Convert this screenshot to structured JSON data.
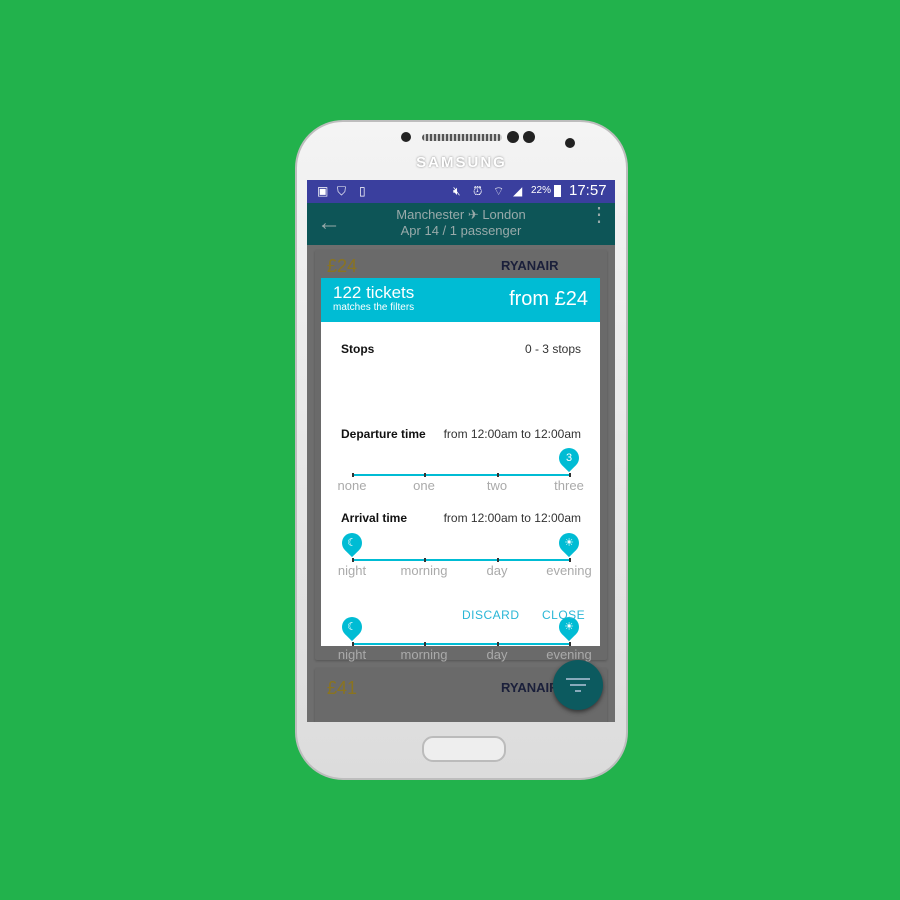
{
  "device": {
    "brand": "SAMSUNG"
  },
  "status_bar": {
    "battery": "22%",
    "time": "17:57"
  },
  "app_bar": {
    "title": "Manchester ✈ London",
    "subtitle": "Apr 14 / 1 passenger"
  },
  "results": [
    {
      "price": "£24",
      "airline": "RYANAIR"
    },
    {
      "price": "£41",
      "airline": "RYANAIR"
    }
  ],
  "dialog": {
    "count": "122 tickets",
    "count_sub": "matches the filters",
    "price": "from £24",
    "stops": {
      "label": "Stops",
      "value": "0 - 3 stops",
      "ticks": [
        "none",
        "one",
        "two",
        "three"
      ],
      "selected": 3,
      "pin": "3"
    },
    "departure": {
      "label": "Departure time",
      "value": "from 12:00am to 12:00am",
      "ticks": [
        "night",
        "morning",
        "day",
        "evening"
      ]
    },
    "arrival": {
      "label": "Arrival time",
      "value": "from 12:00am to 12:00am",
      "ticks": [
        "night",
        "morning",
        "day",
        "evening"
      ]
    },
    "discard": "DISCARD",
    "close": "CLOSE"
  },
  "colors": {
    "accent": "#00bcd4",
    "appbar": "#00796b",
    "background": "#22b24c"
  }
}
